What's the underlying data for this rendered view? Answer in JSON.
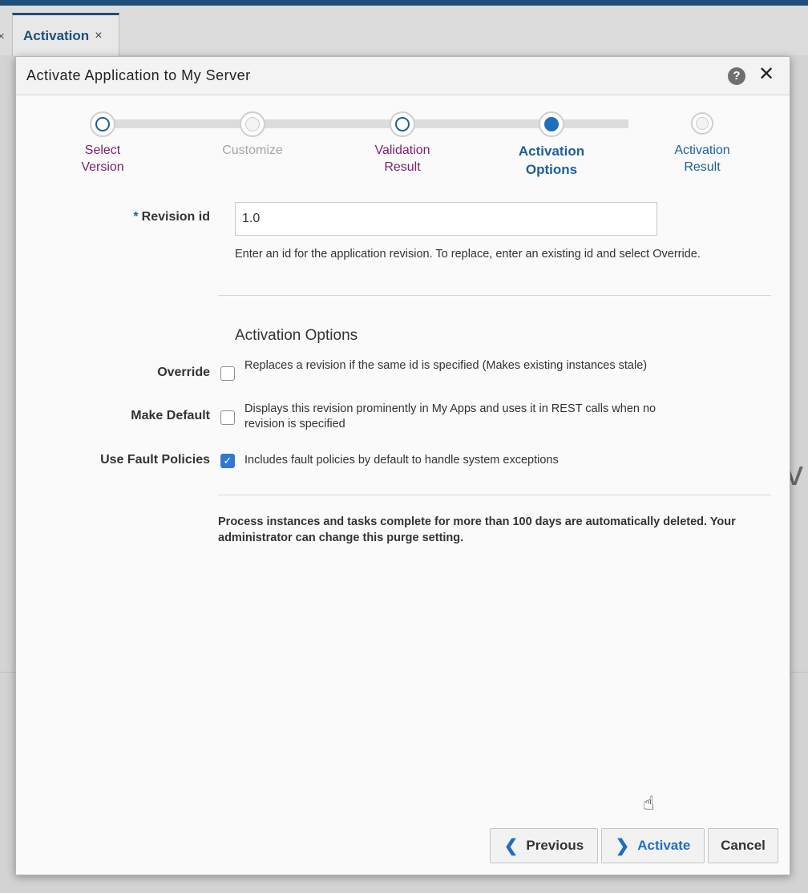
{
  "tab": {
    "label": "Activation",
    "close": "×",
    "prev_close": "×"
  },
  "background": {
    "partial_text": "tiv"
  },
  "dialog": {
    "title": "Activate Application to My Server",
    "help_icon": "?",
    "close_icon": "✕"
  },
  "train": {
    "steps": [
      {
        "line1": "Select",
        "line2": "Version",
        "state": "visited"
      },
      {
        "line1": "Customize",
        "line2": "",
        "state": "disabled"
      },
      {
        "line1": "Validation",
        "line2": "Result",
        "state": "visited"
      },
      {
        "line1": "Activation",
        "line2": "Options",
        "state": "current"
      },
      {
        "line1": "Activation",
        "line2": "Result",
        "state": "unvisited"
      }
    ]
  },
  "form": {
    "revision": {
      "required_marker": "*",
      "label": "Revision id",
      "value": "1.0",
      "help": "Enter an id for the application revision. To replace, enter an existing id and select Override."
    },
    "section_title": "Activation Options",
    "options": [
      {
        "label": "Override",
        "checked": false,
        "desc": "Replaces a revision if the same id is specified (Makes existing instances stale)"
      },
      {
        "label": "Make Default",
        "checked": false,
        "desc": "Displays this revision prominently in My Apps and uses it in REST calls when no revision is specified"
      },
      {
        "label": "Use Fault Policies",
        "checked": true,
        "desc": "Includes fault policies by default to handle system exceptions"
      }
    ],
    "purge_note": "Process instances and tasks complete for more than 100 days are automatically deleted. Your administrator can change this purge setting."
  },
  "buttons": {
    "previous": "Previous",
    "activate": "Activate",
    "cancel": "Cancel"
  },
  "colors": {
    "brand": "#1f4e79",
    "accent": "#1f6fbf",
    "visited_step": "#7a1f6e",
    "disabled_step": "#a4a4a4"
  }
}
